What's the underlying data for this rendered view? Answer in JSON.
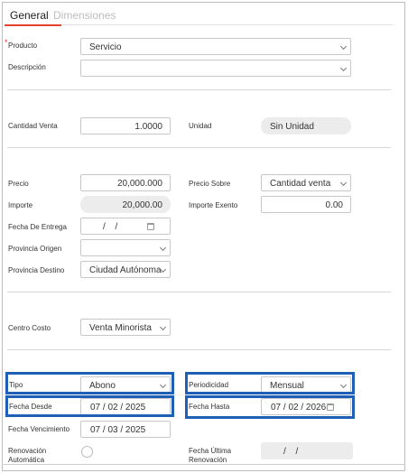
{
  "tabs": {
    "general": "General",
    "dimensiones": "Dimensiones"
  },
  "required_mark": "*",
  "producto": {
    "label": "Producto",
    "value": "Servicio"
  },
  "descripcion": {
    "label": "Descripción",
    "value": ""
  },
  "cantidad_venta": {
    "label": "Cantidad Venta",
    "value": "1.0000"
  },
  "unidad": {
    "label": "Unidad",
    "value": "Sin Unidad"
  },
  "precio": {
    "label": "Precio",
    "value": "20,000.000"
  },
  "precio_sobre": {
    "label": "Precio Sobre",
    "value": "Cantidad venta"
  },
  "importe": {
    "label": "Importe",
    "value": "20,000.00"
  },
  "importe_exento": {
    "label": "Importe Exento",
    "value": "0.00"
  },
  "fecha_entrega": {
    "label": "Fecha De Entrega",
    "value": "/ /"
  },
  "provincia_origen": {
    "label": "Provincia Origen",
    "value": ""
  },
  "provincia_destino": {
    "label": "Provincia Destino",
    "value": "Ciudad Autónoma"
  },
  "centro_costo": {
    "label": "Centro Costo",
    "value": "Venta Minorista"
  },
  "tipo": {
    "label": "Tipo",
    "value": "Abono"
  },
  "periodicidad": {
    "label": "Periodicidad",
    "value": "Mensual"
  },
  "fecha_desde": {
    "label": "Fecha Desde",
    "value": "07 / 02 / 2025"
  },
  "fecha_hasta": {
    "label": "Fecha Hasta",
    "value": "07 / 02 / 2026"
  },
  "fecha_vencimiento": {
    "label": "Fecha Vencimiento",
    "value": "07 / 03 / 2025"
  },
  "renovacion_automatica": {
    "label_line1": "Renovación",
    "label_line2": "Automática"
  },
  "fecha_ultima_renovacion": {
    "label_line1": "Fecha Última",
    "label_line2": "Renovación",
    "value": "/ /"
  },
  "colors": {
    "accent_tab": "#e8412b",
    "highlight": "#1f5fb5",
    "required": "#e53935"
  }
}
